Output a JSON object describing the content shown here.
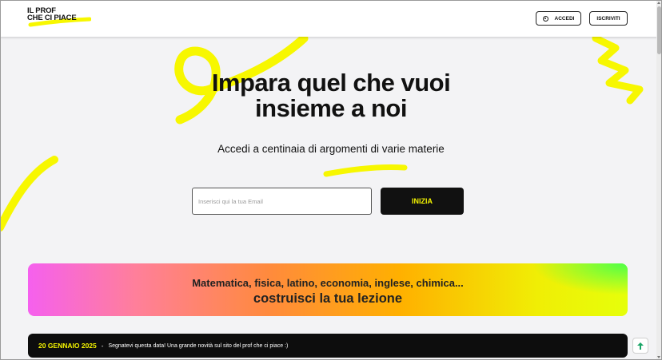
{
  "header": {
    "logo_line1": "IL PROF",
    "logo_line2": "CHE CI PIACE",
    "login_label": "ACCEDI",
    "register_label": "ISCRIVITI"
  },
  "hero": {
    "title_line1": "Impara quel che vuoi",
    "title_line2": "insieme a noi",
    "subtitle": "Accedi a centinaia di argomenti di varie materie",
    "email_placeholder": "Inserisci qui la tua Email",
    "email_value": "",
    "start_label": "INIZIA"
  },
  "promo": {
    "line1": "Matematica, fisica, latino, economia, inglese, chimica...",
    "line2": "costruisci la tua lezione"
  },
  "news": {
    "date": "20 GENNAIO 2025",
    "separator": "-",
    "text": "Segnatevi questa data! Una grande novità sul sito del prof che ci piace :)"
  },
  "icons": {
    "login": "user-circle-icon",
    "scroll_top": "arrow-up-icon"
  },
  "colors": {
    "accent_yellow": "#f5f500",
    "dark": "#111111",
    "background": "#f3f3f5"
  }
}
